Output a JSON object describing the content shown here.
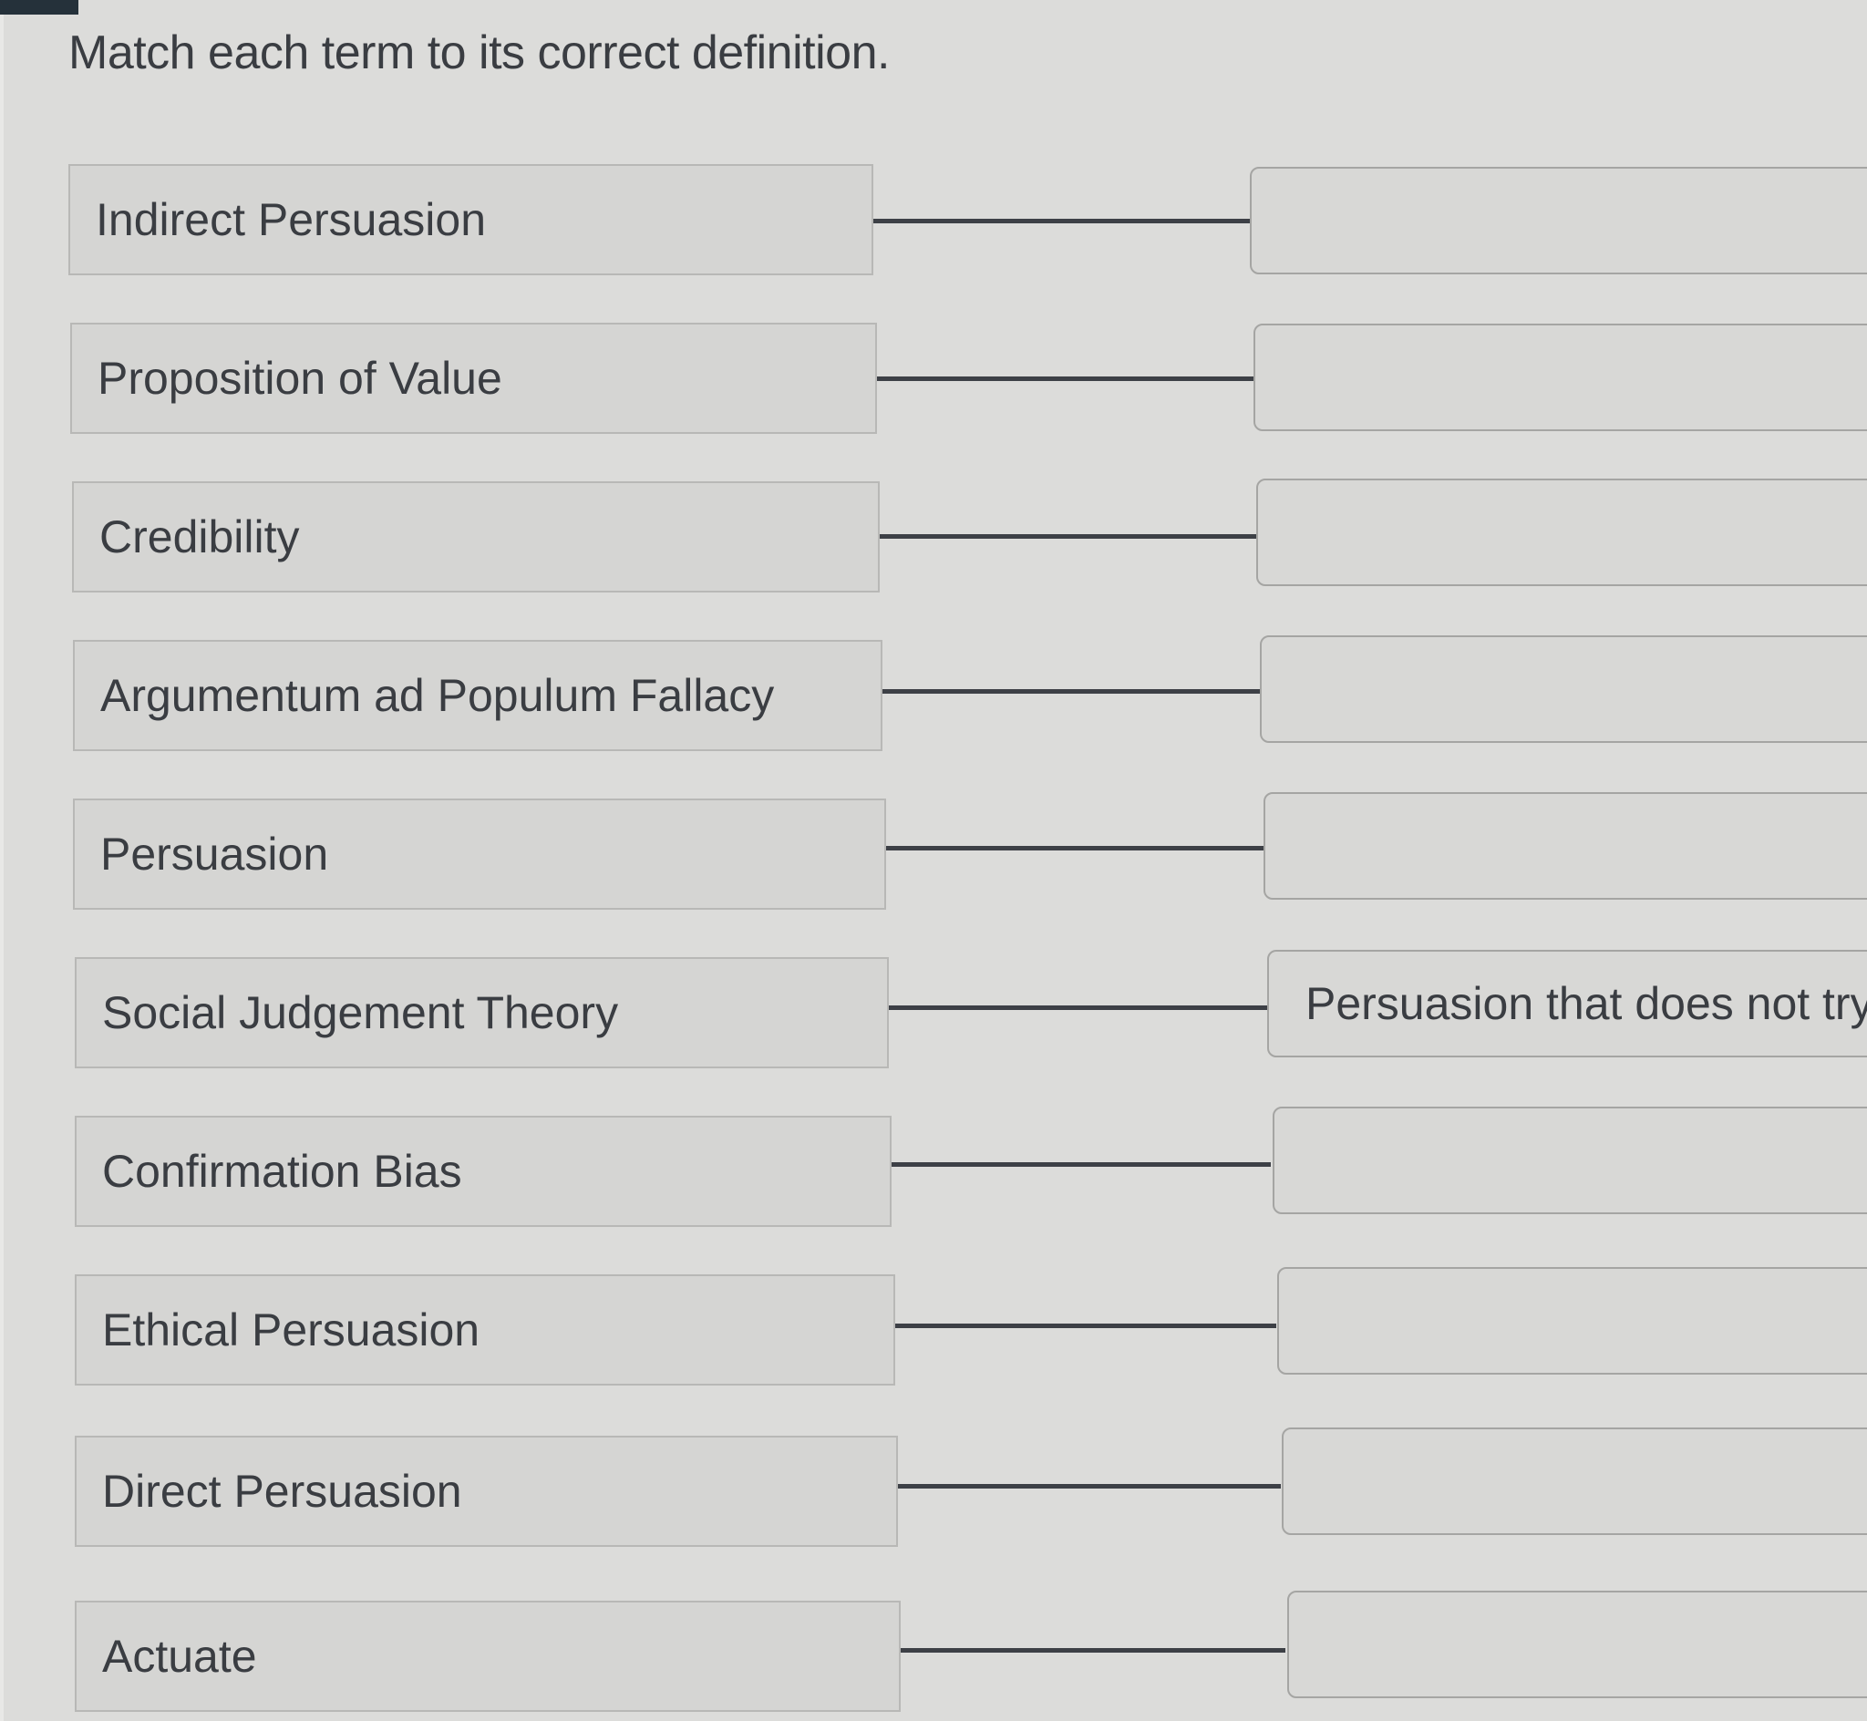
{
  "prompt": "Match each term to its correct definition.",
  "terms": [
    {
      "label": "Indirect Persuasion"
    },
    {
      "label": "Proposition of Value"
    },
    {
      "label": "Credibility"
    },
    {
      "label": "Argumentum ad Populum Fallacy"
    },
    {
      "label": "Persuasion"
    },
    {
      "label": "Social Judgement Theory"
    },
    {
      "label": "Confirmation Bias"
    },
    {
      "label": "Ethical Persuasion"
    },
    {
      "label": "Direct Persuasion"
    },
    {
      "label": "Actuate"
    }
  ],
  "definitions": [
    {
      "text": ""
    },
    {
      "text": ""
    },
    {
      "text": ""
    },
    {
      "text": ""
    },
    {
      "text": ""
    },
    {
      "text": "Persuasion that does not try"
    },
    {
      "text": ""
    },
    {
      "text": ""
    },
    {
      "text": ""
    },
    {
      "text": ""
    }
  ]
}
